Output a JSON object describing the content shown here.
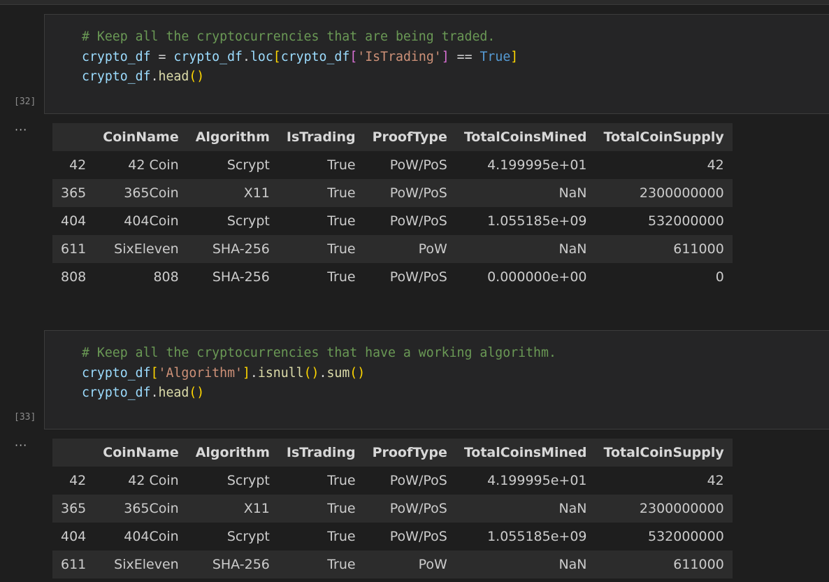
{
  "cells": [
    {
      "exec_count": "[32]",
      "code_lines": [
        [
          {
            "t": "comment",
            "v": "# Keep all the cryptocurrencies that are being traded."
          }
        ],
        [
          {
            "t": "var",
            "v": "crypto_df"
          },
          {
            "t": "op",
            "v": " = "
          },
          {
            "t": "var",
            "v": "crypto_df"
          },
          {
            "t": "op",
            "v": "."
          },
          {
            "t": "var",
            "v": "loc"
          },
          {
            "t": "br1",
            "v": "["
          },
          {
            "t": "var",
            "v": "crypto_df"
          },
          {
            "t": "br2",
            "v": "["
          },
          {
            "t": "str",
            "v": "'IsTrading'"
          },
          {
            "t": "br2",
            "v": "]"
          },
          {
            "t": "op",
            "v": " == "
          },
          {
            "t": "kw",
            "v": "True"
          },
          {
            "t": "br1",
            "v": "]"
          }
        ],
        [
          {
            "t": "var",
            "v": "crypto_df"
          },
          {
            "t": "op",
            "v": "."
          },
          {
            "t": "fn",
            "v": "head"
          },
          {
            "t": "br1",
            "v": "()"
          }
        ]
      ],
      "output": {
        "columns": [
          "",
          "CoinName",
          "Algorithm",
          "IsTrading",
          "ProofType",
          "TotalCoinsMined",
          "TotalCoinSupply"
        ],
        "rows": [
          [
            "42",
            "42 Coin",
            "Scrypt",
            "True",
            "PoW/PoS",
            "4.199995e+01",
            "42"
          ],
          [
            "365",
            "365Coin",
            "X11",
            "True",
            "PoW/PoS",
            "NaN",
            "2300000000"
          ],
          [
            "404",
            "404Coin",
            "Scrypt",
            "True",
            "PoW/PoS",
            "1.055185e+09",
            "532000000"
          ],
          [
            "611",
            "SixEleven",
            "SHA-256",
            "True",
            "PoW",
            "NaN",
            "611000"
          ],
          [
            "808",
            "808",
            "SHA-256",
            "True",
            "PoW/PoS",
            "0.000000e+00",
            "0"
          ]
        ]
      }
    },
    {
      "exec_count": "[33]",
      "code_lines": [
        [
          {
            "t": "comment",
            "v": "# Keep all the cryptocurrencies that have a working algorithm."
          }
        ],
        [
          {
            "t": "var",
            "v": "crypto_df"
          },
          {
            "t": "br1",
            "v": "["
          },
          {
            "t": "str",
            "v": "'Algorithm'"
          },
          {
            "t": "br1",
            "v": "]"
          },
          {
            "t": "op",
            "v": "."
          },
          {
            "t": "fn",
            "v": "isnull"
          },
          {
            "t": "br1",
            "v": "()"
          },
          {
            "t": "op",
            "v": "."
          },
          {
            "t": "fn",
            "v": "sum"
          },
          {
            "t": "br1",
            "v": "()"
          }
        ],
        [
          {
            "t": "var",
            "v": "crypto_df"
          },
          {
            "t": "op",
            "v": "."
          },
          {
            "t": "fn",
            "v": "head"
          },
          {
            "t": "br1",
            "v": "()"
          }
        ]
      ],
      "output": {
        "columns": [
          "",
          "CoinName",
          "Algorithm",
          "IsTrading",
          "ProofType",
          "TotalCoinsMined",
          "TotalCoinSupply"
        ],
        "rows": [
          [
            "42",
            "42 Coin",
            "Scrypt",
            "True",
            "PoW/PoS",
            "4.199995e+01",
            "42"
          ],
          [
            "365",
            "365Coin",
            "X11",
            "True",
            "PoW/PoS",
            "NaN",
            "2300000000"
          ],
          [
            "404",
            "404Coin",
            "Scrypt",
            "True",
            "PoW/PoS",
            "1.055185e+09",
            "532000000"
          ],
          [
            "611",
            "SixEleven",
            "SHA-256",
            "True",
            "PoW",
            "NaN",
            "611000"
          ]
        ]
      }
    }
  ],
  "more_icon": "more-horizontal-icon",
  "more_glyph": "···",
  "colors": {
    "background": "#1e1e1e",
    "cell_background": "#252526",
    "comment": "#6a9955",
    "variable": "#9cdcfe",
    "function": "#dcdcaa",
    "string": "#ce9178",
    "keyword": "#569cd6",
    "bracket_1": "#ffd700",
    "bracket_2": "#da70d6"
  }
}
